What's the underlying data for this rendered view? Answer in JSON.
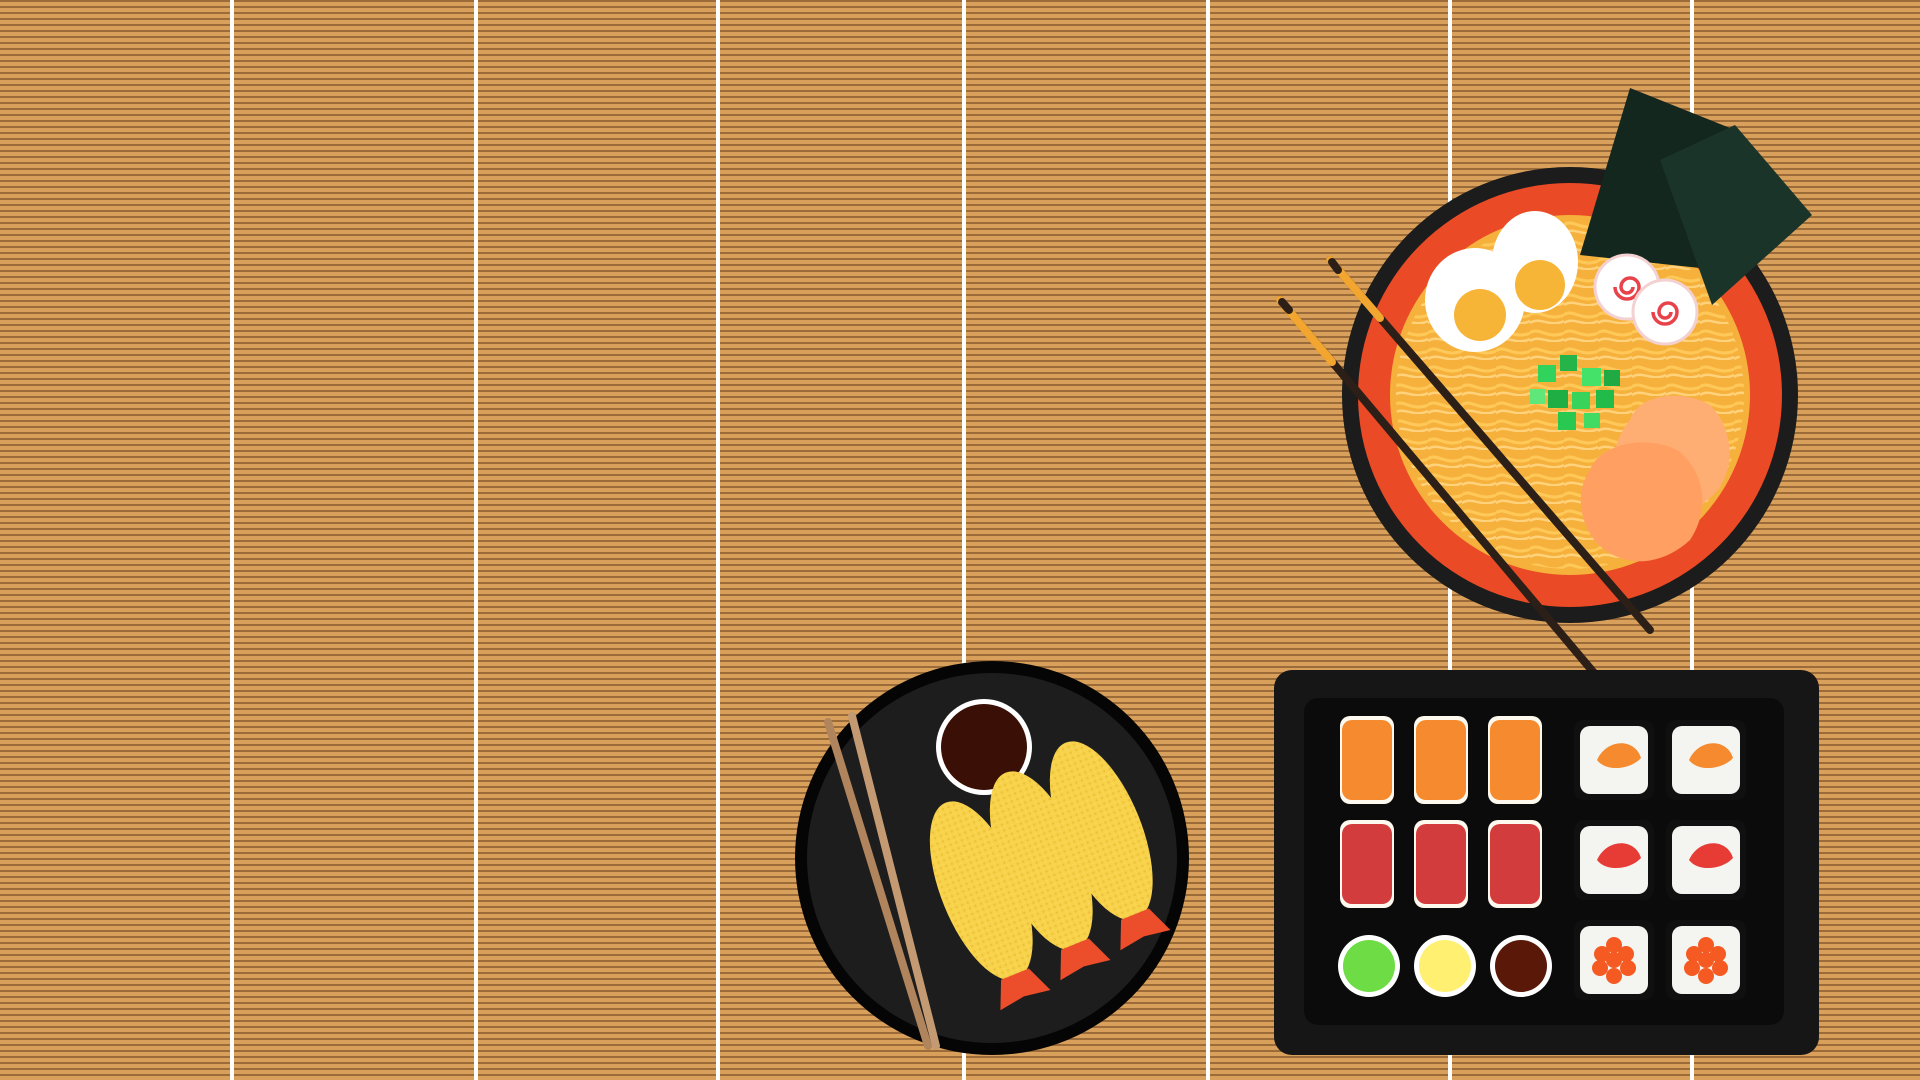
{
  "scene": {
    "name": "japanese-food-table-illustration",
    "colors": {
      "bamboo_base": "#d9a05b",
      "bamboo_stripe": "#9b6b3a",
      "bamboo_divider": "#ffffff",
      "ramen_bowl_outer": "#1c1c1c",
      "ramen_bowl_red": "#ea4a25",
      "ramen_broth": "#f6b13c",
      "noodle": "#ffc95a",
      "egg_white": "#ffffff",
      "egg_yolk": "#f7b538",
      "nori": "#13271e",
      "scallion": "#31d35c",
      "naruto_swirl": "#e8424a",
      "chashu": "#ffae73",
      "chopstick_dark": "#2c1f18",
      "chopstick_tip": "#f3a62f",
      "tempura_plate": "#1d1d1d",
      "soy_sauce": "#3a0f05",
      "tempura_batter": "#f7d24a",
      "shrimp_tail": "#ec4d2b",
      "wood_chopstick": "#b0845c",
      "sushi_tray": "#161616",
      "salmon": "#f58a2e",
      "tuna": "#d33c3c",
      "wasabi": "#6edd45",
      "ginger": "#fff072",
      "sauce_dish": "#5a1908",
      "roll_rice": "#f4f4f1",
      "roe": "#f45a21"
    }
  },
  "objects": {
    "mat": "bamboo-mat",
    "ramen": "ramen-bowl",
    "tempura": "tempura-plate",
    "sushi": "sushi-tray"
  },
  "icons": {
    "ramen_bowl": "ramen-bowl-icon",
    "egg": "boiled-egg-icon",
    "nori": "nori-icon",
    "naruto": "naruto-icon",
    "scallion": "scallion-icon",
    "chashu": "chashu-icon",
    "chopsticks": "chopsticks-icon",
    "soy_dish": "soy-sauce-dish-icon",
    "tempura": "shrimp-tempura-icon",
    "nigiri_salmon": "salmon-nigiri-icon",
    "nigiri_tuna": "tuna-nigiri-icon",
    "maki_salmon": "salmon-maki-icon",
    "maki_tuna": "tuna-maki-icon",
    "maki_roe": "roe-maki-icon",
    "wasabi": "wasabi-icon",
    "ginger": "ginger-icon",
    "sauce": "sauce-icon"
  }
}
